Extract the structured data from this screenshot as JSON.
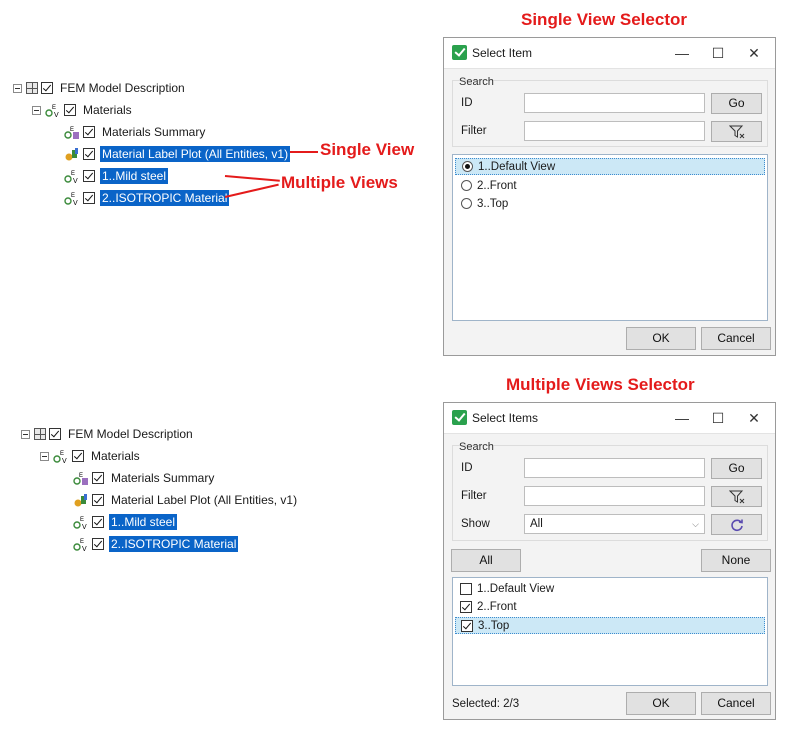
{
  "colors": {
    "accent_red": "#e41b1b",
    "selection_blue": "#0a64c8",
    "list_selection": "#cce8f6",
    "dialog_bg": "#f3f3f3"
  },
  "callouts": {
    "single_selector_heading": "Single View Selector",
    "multiple_selector_heading": "Multiple Views Selector",
    "single_view": "Single View",
    "multiple_views": "Multiple Views"
  },
  "tree_top": {
    "root": "FEM Model Description",
    "materials": "Materials",
    "items": [
      "Materials Summary",
      "Material Label Plot (All Entities, v1)",
      "1..Mild steel",
      "2..ISOTROPIC Material"
    ]
  },
  "tree_bottom": {
    "root": "FEM Model Description",
    "materials": "Materials",
    "items": [
      "Materials Summary",
      "Material Label Plot (All Entities, v1)",
      "1..Mild steel",
      "2..ISOTROPIC Material"
    ]
  },
  "dialog_single": {
    "title": "Select Item",
    "minimize": "—",
    "maximize": "☐",
    "close": "✕",
    "search_group": "Search",
    "id_label": "ID",
    "go_label": "Go",
    "filter_label": "Filter",
    "items": [
      "1..Default View",
      "2..Front",
      "3..Top"
    ],
    "selected_index": 0,
    "ok": "OK",
    "cancel": "Cancel"
  },
  "dialog_multi": {
    "title": "Select Items",
    "minimize": "—",
    "maximize": "☐",
    "close": "✕",
    "search_group": "Search",
    "id_label": "ID",
    "go_label": "Go",
    "filter_label": "Filter",
    "show_label": "Show",
    "show_value": "All",
    "all_button": "All",
    "none_button": "None",
    "items": [
      "1..Default View",
      "2..Front",
      "3..Top"
    ],
    "checked": [
      false,
      true,
      true
    ],
    "status": "Selected: 2/3",
    "ok": "OK",
    "cancel": "Cancel"
  },
  "icons": [
    "checkbox-icon",
    "ev-material-icon",
    "summary-icon",
    "label-plot-icon",
    "grid-icon",
    "filter-icon",
    "refresh-icon"
  ]
}
